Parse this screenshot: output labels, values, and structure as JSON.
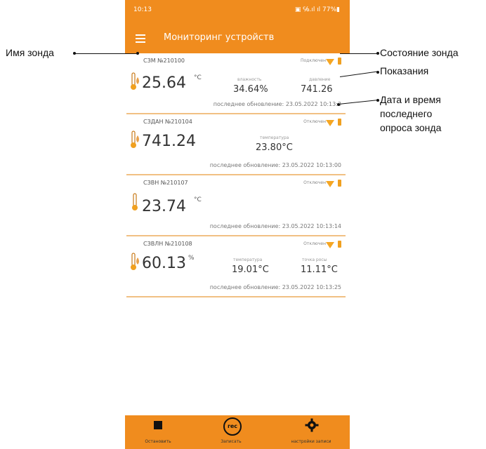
{
  "status": {
    "time": "10:13",
    "icons": "▣ ℅.ıl ıl 77%▮"
  },
  "app": {
    "title": "Мониторинг устройств"
  },
  "cards": [
    {
      "name": "СЗМ №210100",
      "state": "Подключен",
      "value": "25.64",
      "unit": "°C",
      "readings": [
        {
          "label": "влажность",
          "value": "34.64%"
        },
        {
          "label": "давление",
          "value": "741.26"
        }
      ],
      "updated_label": "последнее обновление:",
      "updated_value": "23.05.2022 10:13:3"
    },
    {
      "name": "СЗДАН №210104",
      "state": "Отключен",
      "value": "741.24",
      "unit": "",
      "readings": [
        {
          "label": "температура",
          "value": "23.80°C"
        }
      ],
      "updated_label": "последнее обновление:",
      "updated_value": "23.05.2022 10:13:00"
    },
    {
      "name": "СЗВН №210107",
      "state": "Отключен",
      "value": "23.74",
      "unit": "°C",
      "readings": [],
      "updated_label": "последнее обновление:",
      "updated_value": "23.05.2022 10:13:14"
    },
    {
      "name": "СЗВЛН №210108",
      "state": "Отключен",
      "value": "60.13",
      "unit": "%",
      "readings": [
        {
          "label": "температура",
          "value": "19.01°C"
        },
        {
          "label": "точка росы",
          "value": "11.11°C"
        }
      ],
      "updated_label": "последнее обновление:",
      "updated_value": "23.05.2022 10:13:25"
    }
  ],
  "bottom": {
    "stop_label": "Остановить",
    "record_label": "Записать",
    "record_icon_text": "rec",
    "settings_label": "настройки записи"
  },
  "annotations": {
    "probe_name": "Имя зонда",
    "probe_state": "Состояние зонда",
    "readings": "Показания",
    "datetime": "Дата и время\nпоследнего\nопроса зонда"
  },
  "colors": {
    "accent": "#f08c1e",
    "divider": "#f1c083"
  }
}
